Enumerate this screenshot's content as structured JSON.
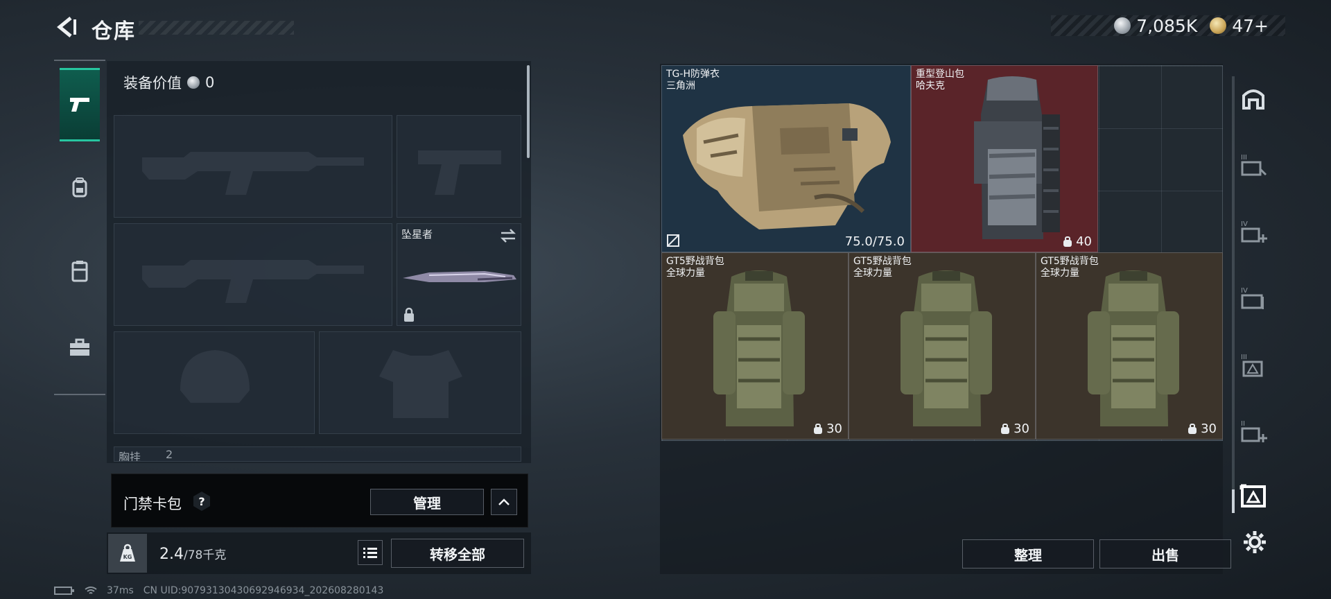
{
  "header": {
    "title": "仓库",
    "currency_primary": "7,085K",
    "currency_secondary": "47+"
  },
  "left_tabs": [
    {
      "icon": "pistol-icon",
      "active": true
    },
    {
      "icon": "backpack-icon",
      "active": false
    },
    {
      "icon": "chest-rig-icon",
      "active": false
    },
    {
      "icon": "toolbox-icon",
      "active": false
    }
  ],
  "equipment": {
    "value_label": "装备价值",
    "value": "0",
    "melee_slot_label": "坠星者",
    "chest_rig_label_partial": "胸挂",
    "chest_rig_count_partial": "2"
  },
  "card_pack": {
    "label": "门禁卡包",
    "help": "?",
    "manage_label": "管理"
  },
  "capacity": {
    "current": "2.4",
    "max": "/78千克",
    "transfer_all_label": "转移全部"
  },
  "items": [
    {
      "name": "TG-H防弹衣",
      "sub": "三角洲",
      "stat": "75.0/75.0",
      "bg": "#1f3344"
    },
    {
      "name": "重型登山包",
      "sub": "哈夫克",
      "stat": "40",
      "bg": "#5a2429"
    },
    {
      "name": "GT5野战背包",
      "sub": "全球力量",
      "stat": "30",
      "bg": "#3c342b"
    },
    {
      "name": "GT5野战背包",
      "sub": "全球力量",
      "stat": "30",
      "bg": "#3c342b"
    },
    {
      "name": "GT5野战背包",
      "sub": "全球力量",
      "stat": "30",
      "bg": "#3c342b"
    }
  ],
  "actions": {
    "sort_label": "整理",
    "sell_label": "出售"
  },
  "status": {
    "ping": "37ms",
    "uid": "CN UID:90793130430692946934_202608280143"
  },
  "colors": {
    "accent": "#27c6a0",
    "armor_bg": "#1f3344",
    "red_item_bg": "#5a2429",
    "green_item_bg": "#3c342b"
  }
}
